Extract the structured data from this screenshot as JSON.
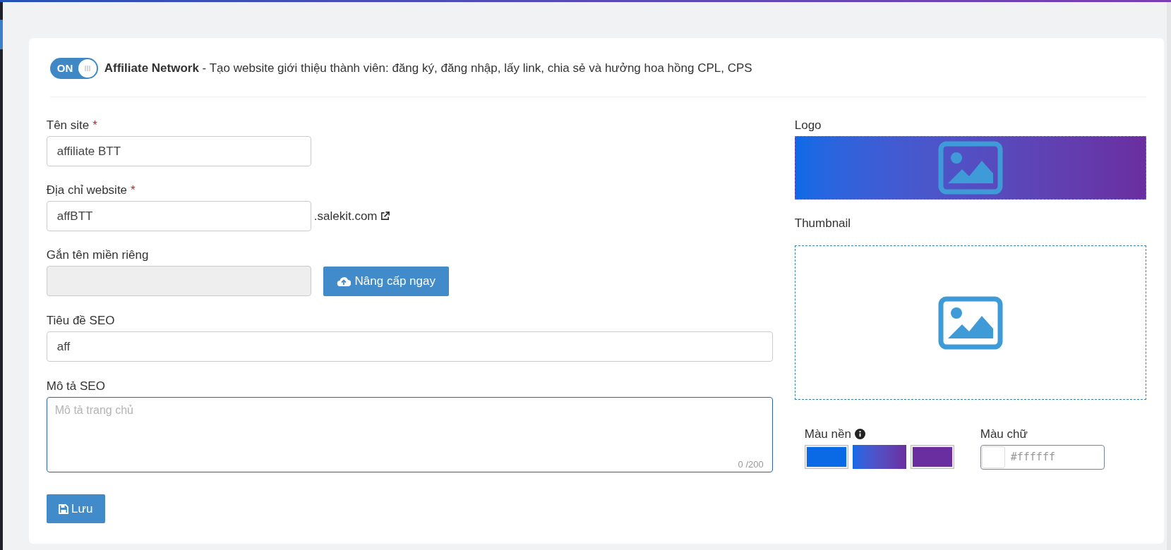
{
  "header": {
    "toggle": {
      "on": true,
      "label": "ON"
    },
    "description": "**Affiliate Network** - Tạo website giới thiệu thành viên: đăng ký, đăng nhập, lấy link, chia sẻ và hưởng hoa hồng CPL, CPS"
  },
  "form": {
    "site_name": {
      "label": "Tên site",
      "required_mark": "*",
      "value": "affiliate BTT"
    },
    "website": {
      "label": "Địa chỉ website",
      "required_mark": "*",
      "value": "affBTT",
      "suffix": ".salekit.com"
    },
    "custom_domain": {
      "label": "Gắn tên miền riêng",
      "disabled": true,
      "button": "Nâng cấp ngay"
    },
    "seo_title": {
      "label": "Tiêu đề SEO",
      "value": "aff"
    },
    "seo_description": {
      "label": "Mô tả SEO",
      "placeholder": "Mô tả trang chủ",
      "counter": "0 /200"
    },
    "save_button": "Lưu"
  },
  "media": {
    "logo": {
      "label": "Logo"
    },
    "thumbnail": {
      "label": "Thumbnail"
    },
    "background_color": {
      "label": "Màu nền",
      "swatches": [
        {
          "kind": "solid",
          "color": "#0a6ae6",
          "selected": false
        },
        {
          "kind": "gradient",
          "selected": true
        },
        {
          "kind": "solid",
          "color": "#6a2ea0",
          "selected": false
        }
      ]
    },
    "text_color": {
      "label": "Màu chữ",
      "placeholder": "#ffffff"
    }
  }
}
